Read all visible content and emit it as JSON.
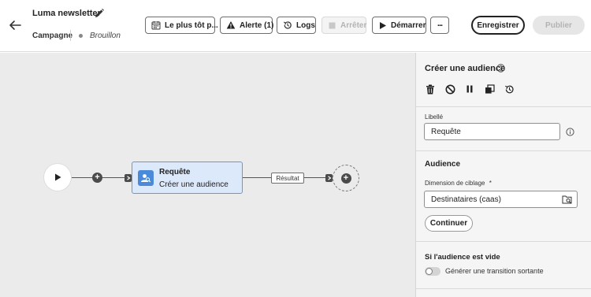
{
  "header": {
    "title": "Luma newsletter",
    "type_label": "Campagne",
    "status": "Brouillon"
  },
  "toolbar": {
    "schedule_label": "Le plus tôt p...",
    "alert_label": "Alerte (1)",
    "logs_label": "Logs",
    "stop_label": "Arrêter",
    "start_label": "Démarrer",
    "more_label": "...",
    "save_label": "Enregistrer",
    "publish_label": "Publier"
  },
  "workflow": {
    "node": {
      "title": "Requête",
      "subtitle": "Créer une audience",
      "icon": "audience-icon"
    },
    "transition_label": "Résultat"
  },
  "panel": {
    "title": "Créer une audience",
    "actions": [
      "delete-icon",
      "disable-icon",
      "pause-icon",
      "copy-icon",
      "history-icon"
    ],
    "label_caption": "Libellé",
    "label_value": "Requête",
    "audience_section": "Audience",
    "targeting_caption": "Dimension de ciblage",
    "required_mark": "*",
    "targeting_value": "Destinataires (caas)",
    "continue_label": "Continuer",
    "empty_section": "Si l'audience est vide",
    "toggle_label": "Générer une transition sortante",
    "toggle_on": false
  },
  "colors": {
    "node_fill": "#dbe9fb",
    "node_border": "#5c9be6",
    "node_icon": "#4a8ad8",
    "canvas": "#ebebeb",
    "panel": "#f5f5f5"
  }
}
